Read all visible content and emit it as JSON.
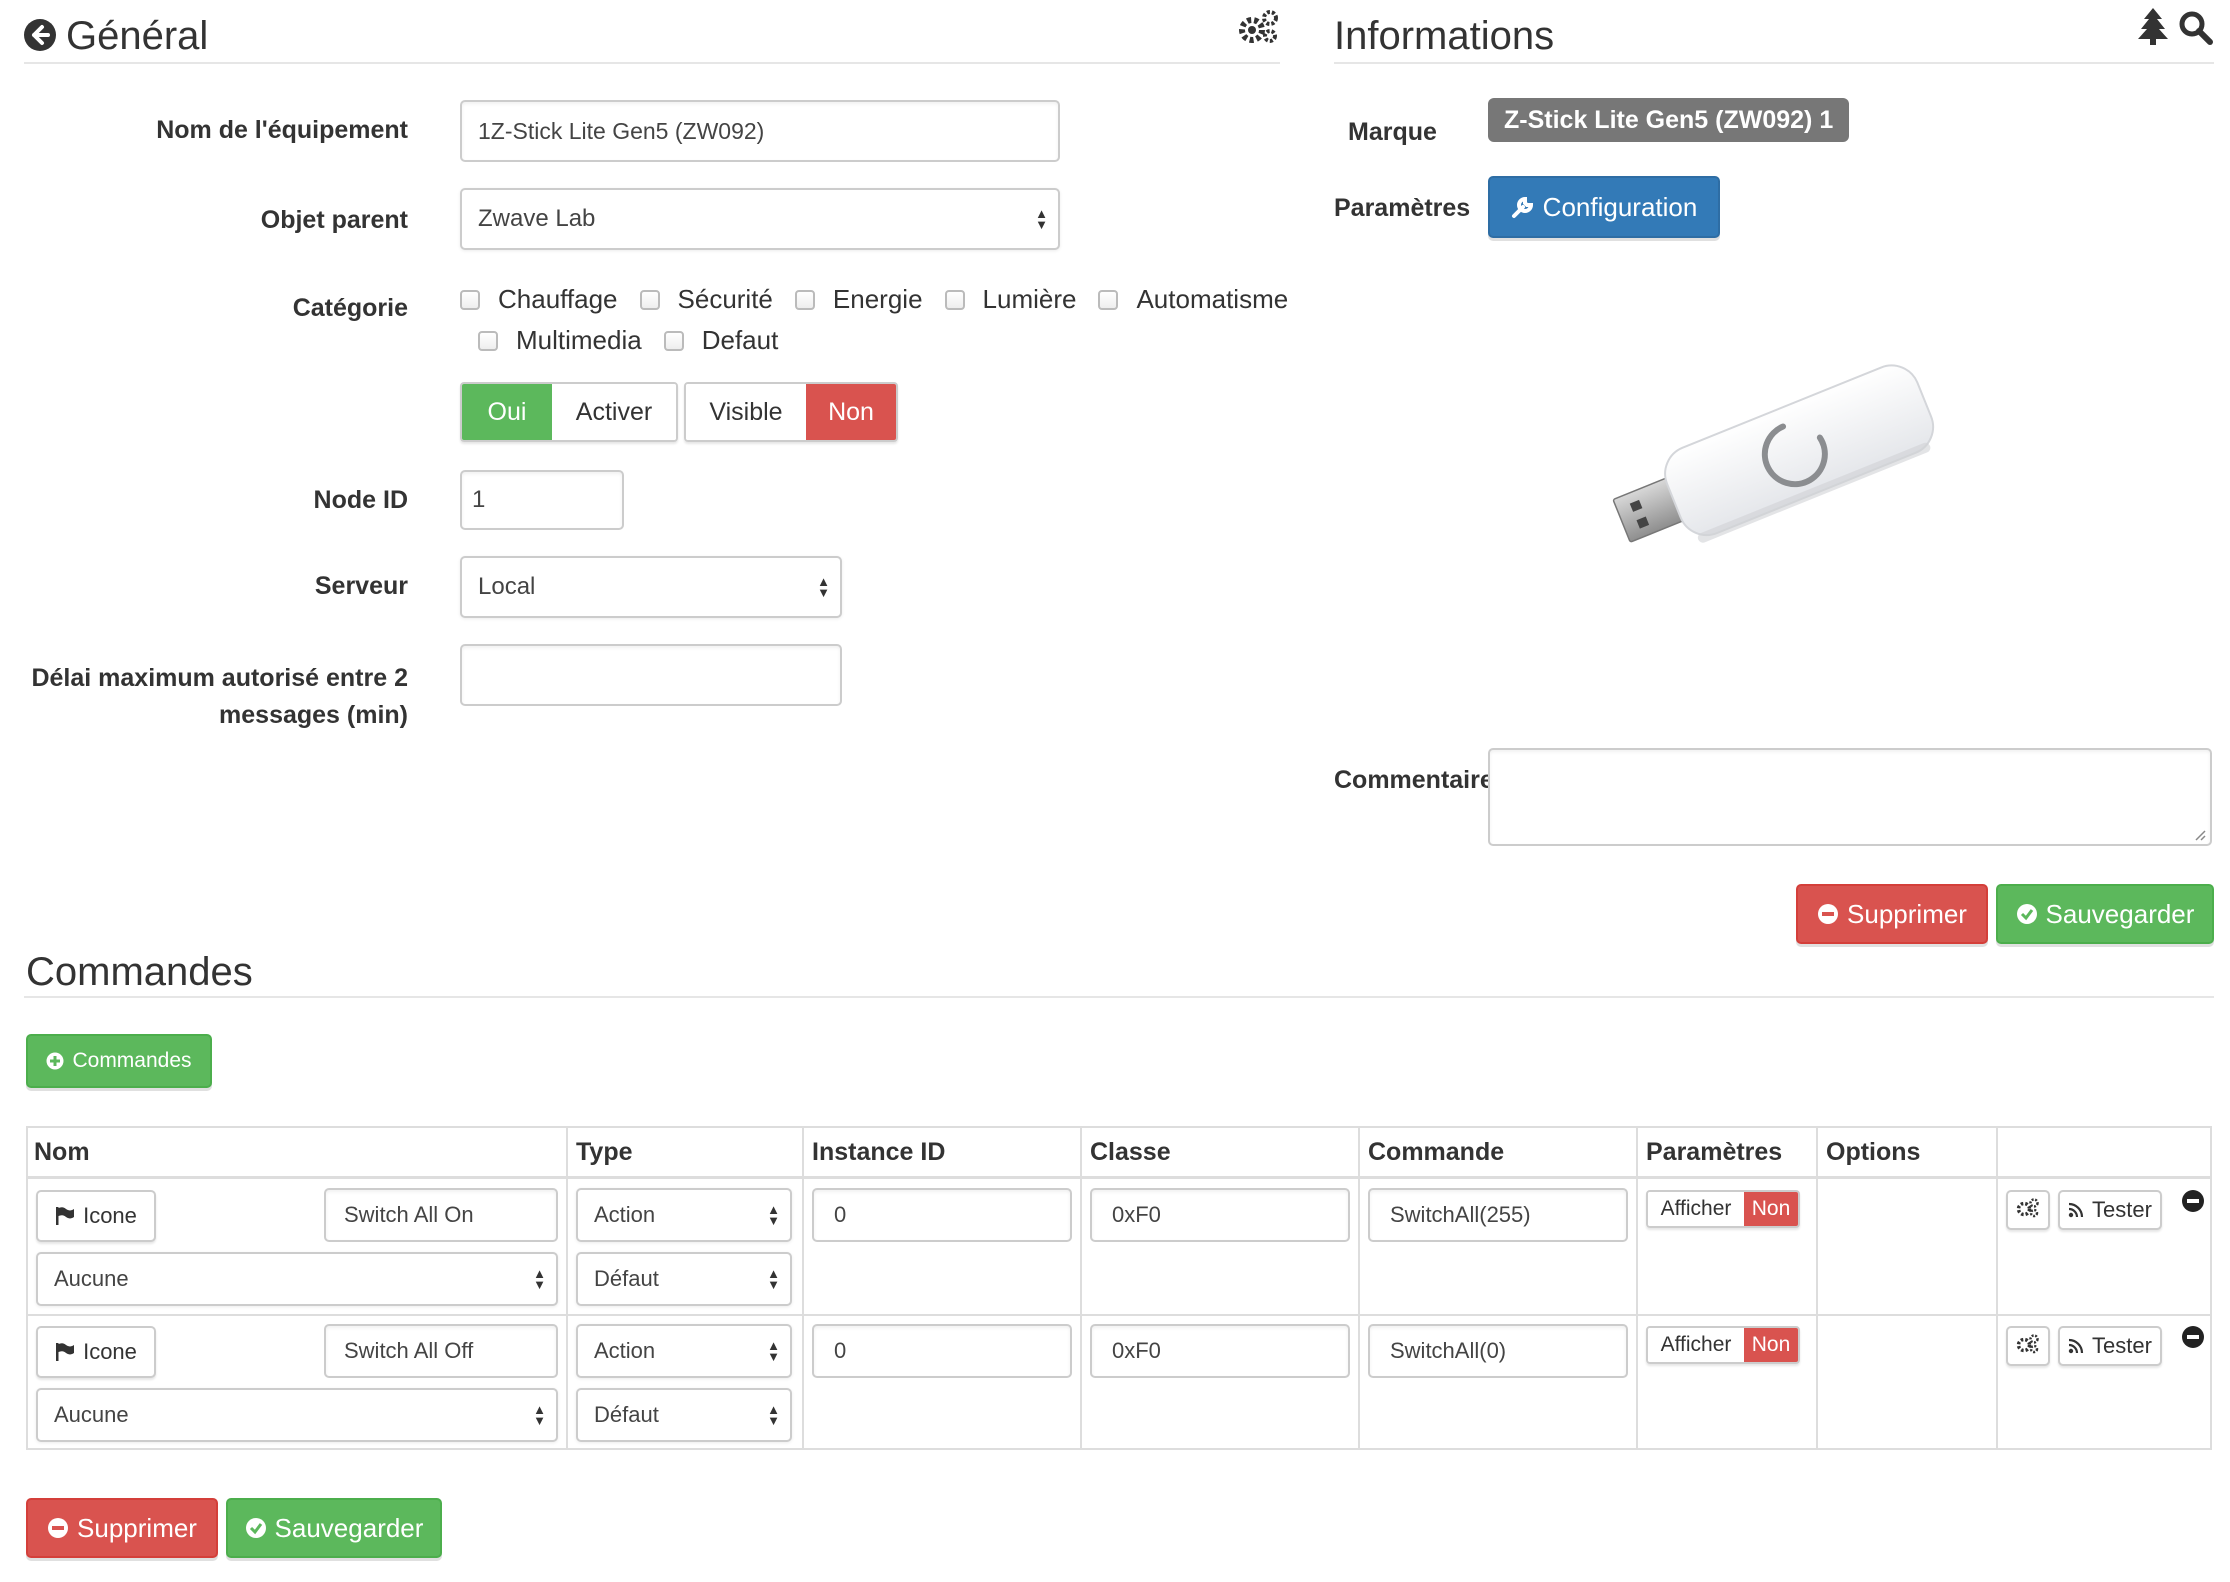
{
  "general": {
    "title": "Général",
    "name_label": "Nom de l'équipement",
    "name_value": "1Z-Stick Lite Gen5 (ZW092)",
    "parent_label": "Objet parent",
    "parent_value": "Zwave Lab",
    "category_label": "Catégorie",
    "categories": [
      "Chauffage",
      "Sécurité",
      "Energie",
      "Lumière",
      "Automatisme",
      "Multimedia",
      "Defaut"
    ],
    "enable_on": "Oui",
    "enable_label": "Activer",
    "visible_label": "Visible",
    "visible_off": "Non",
    "node_label": "Node ID",
    "node_value": "1",
    "server_label": "Serveur",
    "server_value": "Local",
    "delay_label_1": "Délai maximum autorisé entre 2",
    "delay_label_2": "messages (min)",
    "delay_value": ""
  },
  "informations": {
    "title": "Informations",
    "brand_label": "Marque",
    "brand_value": "Z-Stick Lite Gen5 (ZW092) 1",
    "params_label": "Paramètres",
    "config_button": "Configuration",
    "comment_label": "Commentaire",
    "comment_value": "",
    "delete_button": "Supprimer",
    "save_button": "Sauvegarder"
  },
  "commands": {
    "title": "Commandes",
    "add_button": "Commandes",
    "headers": [
      "Nom",
      "Type",
      "Instance ID",
      "Classe",
      "Commande",
      "Paramètres",
      "Options"
    ],
    "rows": [
      {
        "icon_button": "Icone",
        "name": "Switch All On",
        "link": "Aucune",
        "type": "Action",
        "subtype": "Défaut",
        "instance": "0",
        "class": "0xF0",
        "command": "SwitchAll(255)",
        "show": "Afficher",
        "show_off": "Non",
        "test": "Tester"
      },
      {
        "icon_button": "Icone",
        "name": "Switch All Off",
        "link": "Aucune",
        "type": "Action",
        "subtype": "Défaut",
        "instance": "0",
        "class": "0xF0",
        "command": "SwitchAll(0)",
        "show": "Afficher",
        "show_off": "Non",
        "test": "Tester"
      }
    ],
    "delete_button": "Supprimer",
    "save_button": "Sauvegarder"
  },
  "colors": {
    "green": "#5cb85c",
    "red": "#d9534f",
    "blue": "#337ab7",
    "grey_badge": "#777777"
  }
}
